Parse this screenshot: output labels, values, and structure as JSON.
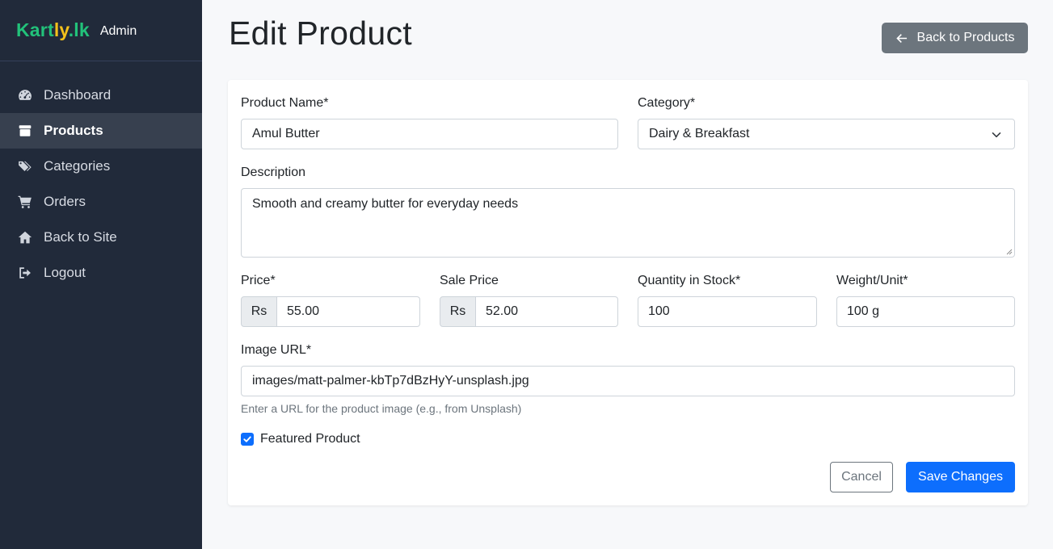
{
  "brand": {
    "logo_part1": "Kart",
    "logo_part2": "ly",
    "logo_part3": ".lk",
    "subtitle": "Admin"
  },
  "sidebar": {
    "items": [
      {
        "label": "Dashboard",
        "icon": "speedometer-icon",
        "active": false
      },
      {
        "label": "Products",
        "icon": "box-icon",
        "active": true
      },
      {
        "label": "Categories",
        "icon": "tags-icon",
        "active": false
      },
      {
        "label": "Orders",
        "icon": "cart-icon",
        "active": false
      },
      {
        "label": "Back to Site",
        "icon": "home-icon",
        "active": false
      },
      {
        "label": "Logout",
        "icon": "logout-icon",
        "active": false
      }
    ]
  },
  "header": {
    "title": "Edit Product",
    "back_label": "Back to Products"
  },
  "form": {
    "product_name": {
      "label": "Product Name*",
      "value": "Amul Butter"
    },
    "category": {
      "label": "Category*",
      "value": "Dairy & Breakfast"
    },
    "description": {
      "label": "Description",
      "value": "Smooth and creamy butter for everyday needs"
    },
    "price": {
      "label": "Price*",
      "prefix": "Rs",
      "value": "55.00"
    },
    "sale_price": {
      "label": "Sale Price",
      "prefix": "Rs",
      "value": "52.00"
    },
    "quantity": {
      "label": "Quantity in Stock*",
      "value": "100"
    },
    "weight": {
      "label": "Weight/Unit*",
      "value": "100 g"
    },
    "image_url": {
      "label": "Image URL*",
      "value": "images/matt-palmer-kbTp7dBzHyY-unsplash.jpg",
      "help": "Enter a URL for the product image (e.g., from Unsplash)"
    },
    "featured": {
      "label": "Featured Product",
      "checked": true
    },
    "cancel_label": "Cancel",
    "save_label": "Save Changes"
  },
  "colors": {
    "sidebar_bg": "#212a3a",
    "primary": "#0d6efd",
    "secondary": "#6c757d",
    "brand_green": "#22c27a",
    "brand_yellow": "#f4c11b"
  }
}
